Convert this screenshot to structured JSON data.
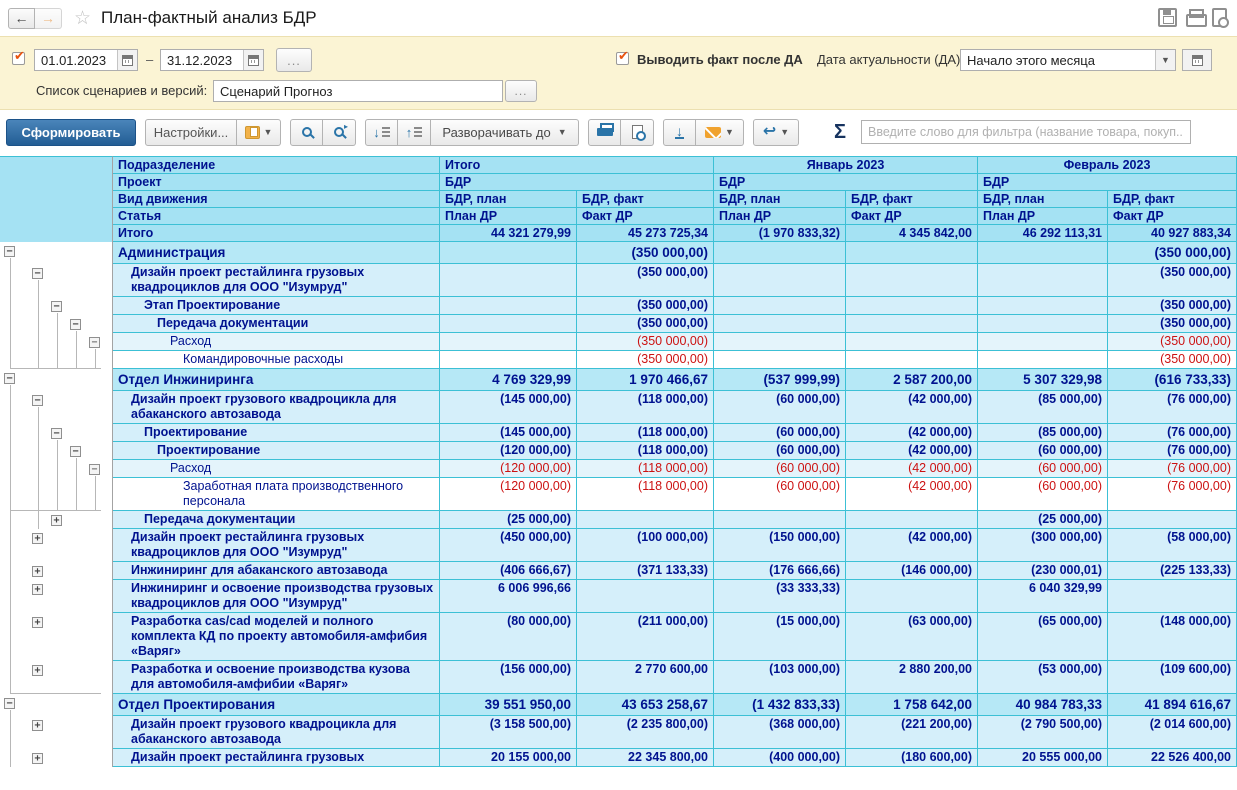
{
  "window": {
    "title": "План-фактный анализ БДР"
  },
  "filters": {
    "period_from": "01.01.2023",
    "period_dash": "–",
    "period_to": "31.12.2023",
    "more_button": "...",
    "fact_after_da_label": "Выводить факт после ДА",
    "da_label": "Дата актуальности (ДА)",
    "da_value": "Начало этого месяца",
    "scenario_label": "Список сценариев и версий:",
    "scenario_value": "Сценарий Прогноз"
  },
  "toolbar": {
    "generate": "Сформировать",
    "settings": "Настройки...",
    "expand_to": "Разворачивать до",
    "sigma": "Σ",
    "filter_placeholder": "Введите слово для фильтра (название товара, покуп..."
  },
  "table": {
    "row_headers": [
      "Подразделение",
      "Проект",
      "Вид движения",
      "Статья",
      "Итого"
    ],
    "col_groups": [
      {
        "title": "Итого",
        "project": "БДР"
      },
      {
        "title": "Январь 2023",
        "project": "БДР"
      },
      {
        "title": "Февраль 2023",
        "project": "БДР"
      }
    ],
    "movement": [
      "БДР, план",
      "БДР, факт"
    ],
    "article": [
      "План ДР",
      "Факт ДР"
    ],
    "totals": [
      "44 321 279,99",
      "45 273 725,34",
      "(1 970 833,32)",
      "4 345 842,00",
      "46 292 113,31",
      "40 927 883,34"
    ],
    "rows": [
      {
        "label": "Администрация",
        "level": 0,
        "box": "-",
        "style": "section",
        "values": [
          "",
          "(350 000,00)",
          "",
          "",
          "",
          "(350 000,00)"
        ],
        "lines": []
      },
      {
        "label": "Дизайн проект рестайлинга грузовых квадроциклов для ООО \"Изумруд\"",
        "level": 1,
        "box": "-",
        "style": "group",
        "values": [
          "",
          "(350 000,00)",
          "",
          "",
          "",
          "(350 000,00)"
        ],
        "lines": [
          0
        ]
      },
      {
        "label": "Этап Проектирование",
        "level": 2,
        "box": "-",
        "style": "group",
        "values": [
          "",
          "(350 000,00)",
          "",
          "",
          "",
          "(350 000,00)"
        ],
        "lines": [
          0,
          1
        ]
      },
      {
        "label": "Передача документации",
        "level": 3,
        "box": "-",
        "style": "group",
        "values": [
          "",
          "(350 000,00)",
          "",
          "",
          "",
          "(350 000,00)"
        ],
        "lines": [
          0,
          1,
          2
        ]
      },
      {
        "label": "Расход",
        "level": 4,
        "box": "-",
        "style": "detail",
        "values": [
          "",
          "(350 000,00)",
          "",
          "",
          "",
          "(350 000,00)"
        ],
        "lines": [
          0,
          1,
          2,
          3
        ]
      },
      {
        "label": "Командировочные расходы",
        "level": 5,
        "box": null,
        "style": "leaf",
        "values": [
          "",
          "(350 000,00)",
          "",
          "",
          "",
          "(350 000,00)"
        ],
        "lines": [
          0,
          1,
          2,
          3,
          4
        ],
        "stub": true
      },
      {
        "label": "Отдел Инжиниринга",
        "level": 0,
        "box": "-",
        "style": "section",
        "values": [
          "4 769 329,99",
          "1 970 466,67",
          "(537 999,99)",
          "2 587 200,00",
          "5 307 329,98",
          "(616 733,33)"
        ],
        "lines": []
      },
      {
        "label": "Дизайн проект грузового квадроцикла для абаканского автозавода",
        "level": 1,
        "box": "-",
        "style": "group",
        "values": [
          "(145 000,00)",
          "(118 000,00)",
          "(60 000,00)",
          "(42 000,00)",
          "(85 000,00)",
          "(76 000,00)"
        ],
        "lines": [
          0
        ]
      },
      {
        "label": "Проектирование",
        "level": 2,
        "box": "-",
        "style": "group",
        "values": [
          "(145 000,00)",
          "(118 000,00)",
          "(60 000,00)",
          "(42 000,00)",
          "(85 000,00)",
          "(76 000,00)"
        ],
        "lines": [
          0,
          1
        ]
      },
      {
        "label": "Проектирование",
        "level": 3,
        "box": "-",
        "style": "group",
        "values": [
          "(120 000,00)",
          "(118 000,00)",
          "(60 000,00)",
          "(42 000,00)",
          "(60 000,00)",
          "(76 000,00)"
        ],
        "lines": [
          0,
          1,
          2
        ]
      },
      {
        "label": "Расход",
        "level": 4,
        "box": "-",
        "style": "detail",
        "values": [
          "(120 000,00)",
          "(118 000,00)",
          "(60 000,00)",
          "(42 000,00)",
          "(60 000,00)",
          "(76 000,00)"
        ],
        "lines": [
          0,
          1,
          2,
          3
        ]
      },
      {
        "label": "Заработная плата производственного персонала",
        "level": 5,
        "box": null,
        "style": "leaf",
        "values": [
          "(120 000,00)",
          "(118 000,00)",
          "(60 000,00)",
          "(42 000,00)",
          "(60 000,00)",
          "(76 000,00)"
        ],
        "lines": [
          0,
          1,
          2,
          3,
          4
        ],
        "stub": true
      },
      {
        "label": "Передача документации",
        "level": 2,
        "box": "+",
        "style": "group",
        "values": [
          "(25 000,00)",
          "",
          "",
          "",
          "(25 000,00)",
          ""
        ],
        "lines": [
          0,
          1
        ]
      },
      {
        "label": "Дизайн проект рестайлинга грузовых квадроциклов для ООО \"Изумруд\"",
        "level": 1,
        "box": "+",
        "style": "group",
        "values": [
          "(450 000,00)",
          "(100 000,00)",
          "(150 000,00)",
          "(42 000,00)",
          "(300 000,00)",
          "(58 000,00)"
        ],
        "lines": [
          0
        ]
      },
      {
        "label": "Инжиниринг для абаканского автозавода",
        "level": 1,
        "box": "+",
        "style": "group",
        "values": [
          "(406 666,67)",
          "(371 133,33)",
          "(176 666,66)",
          "(146 000,00)",
          "(230 000,01)",
          "(225 133,33)"
        ],
        "lines": [
          0
        ]
      },
      {
        "label": "Инжиниринг и освоение производства грузовых квадроциклов для ООО \"Изумруд\"",
        "level": 1,
        "box": "+",
        "style": "group",
        "values": [
          "6 006 996,66",
          "",
          "(33 333,33)",
          "",
          "6 040 329,99",
          ""
        ],
        "lines": [
          0
        ]
      },
      {
        "label": "Разработка cas/cad моделей и полного комплекта КД по проекту автомобиля-амфибия «Варяг»",
        "level": 1,
        "box": "+",
        "style": "group",
        "values": [
          "(80 000,00)",
          "(211 000,00)",
          "(15 000,00)",
          "(63 000,00)",
          "(65 000,00)",
          "(148 000,00)"
        ],
        "lines": [
          0
        ]
      },
      {
        "label": "Разработка и освоение производства кузова для автомобиля-амфибии «Варяг»",
        "level": 1,
        "box": "+",
        "style": "group",
        "values": [
          "(156 000,00)",
          "2 770 600,00",
          "(103 000,00)",
          "2 880 200,00",
          "(53 000,00)",
          "(109 600,00)"
        ],
        "lines": [
          0
        ],
        "stub": true
      },
      {
        "label": "Отдел Проектирования",
        "level": 0,
        "box": "-",
        "style": "section",
        "values": [
          "39 551 950,00",
          "43 653 258,67",
          "(1 432 833,33)",
          "1 758 642,00",
          "40 984 783,33",
          "41 894 616,67"
        ],
        "lines": []
      },
      {
        "label": "Дизайн проект грузового квадроцикла для абаканского автозавода",
        "level": 1,
        "box": "+",
        "style": "group",
        "values": [
          "(3 158 500,00)",
          "(2 235 800,00)",
          "(368 000,00)",
          "(221 200,00)",
          "(2 790 500,00)",
          "(2 014 600,00)"
        ],
        "lines": [
          0
        ]
      },
      {
        "label": "Дизайн проект рестайлинга грузовых",
        "level": 1,
        "box": "+",
        "style": "group",
        "values": [
          "20 155 000,00",
          "22 345 800,00",
          "(400 000,00)",
          "(180 600,00)",
          "20 555 000,00",
          "22 526 400,00"
        ],
        "lines": [
          0
        ]
      }
    ]
  },
  "colors": {
    "accent_blue": "#2a74a8",
    "header_bg": "#a5e2f3",
    "section_bg": "#b6e8f6",
    "group_bg": "#d5effa",
    "grid_line": "#3cc0d5",
    "navy_text": "#00128f",
    "red_text": "#cc1111",
    "panel_yellow": "#fbf4d4",
    "check_orange": "#e8530e"
  }
}
